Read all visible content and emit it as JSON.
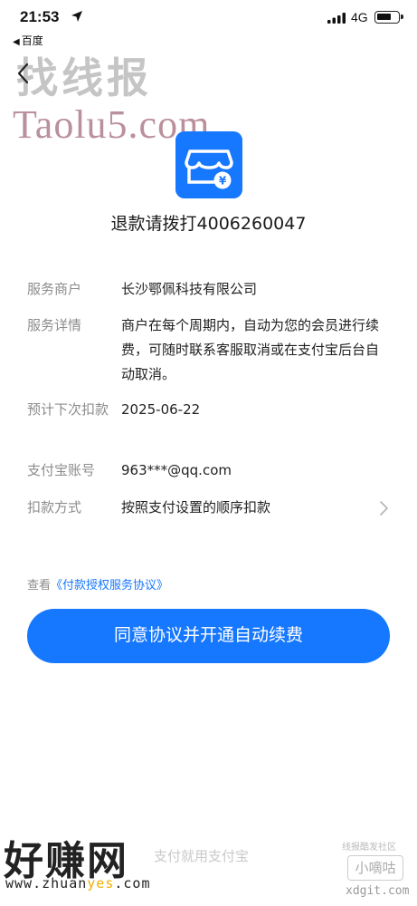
{
  "status_bar": {
    "time": "21:53",
    "back_app": "百度",
    "network": "4G",
    "battery_level": 0.7
  },
  "watermarks": {
    "top_cn": "找线报",
    "top_en": "Taolu5.com",
    "bottom_cn": "好赚网",
    "bottom_url_a": "www.zhuan",
    "bottom_url_b": "yes",
    "bottom_url_c": ".com",
    "br_tag": "线报酷发社区",
    "br_box": "小嘀咕",
    "br_site": "xdgit.com"
  },
  "merchant": {
    "refund_tip": "退款请拨打4006260047"
  },
  "details": [
    {
      "label": "服务商户",
      "value": "长沙鄂佩科技有限公司"
    },
    {
      "label": "服务详情",
      "value": "商户在每个周期内，自动为您的会员进行续费，可随时联系客服取消或在支付宝后台自动取消。"
    },
    {
      "label": "预计下次扣款",
      "value": "2025-06-22"
    },
    {
      "label": "支付宝账号",
      "value": "963***@qq.com"
    },
    {
      "label": "扣款方式",
      "value": "按照支付设置的顺序扣款"
    }
  ],
  "agreement": {
    "prefix": "查看",
    "link": "《付款授权服务协议》"
  },
  "cta_label": "同意协议并开通自动续费",
  "footer": "支付就用支付宝",
  "colors": {
    "accent": "#1677ff",
    "label_gray": "#8c8c8c"
  }
}
